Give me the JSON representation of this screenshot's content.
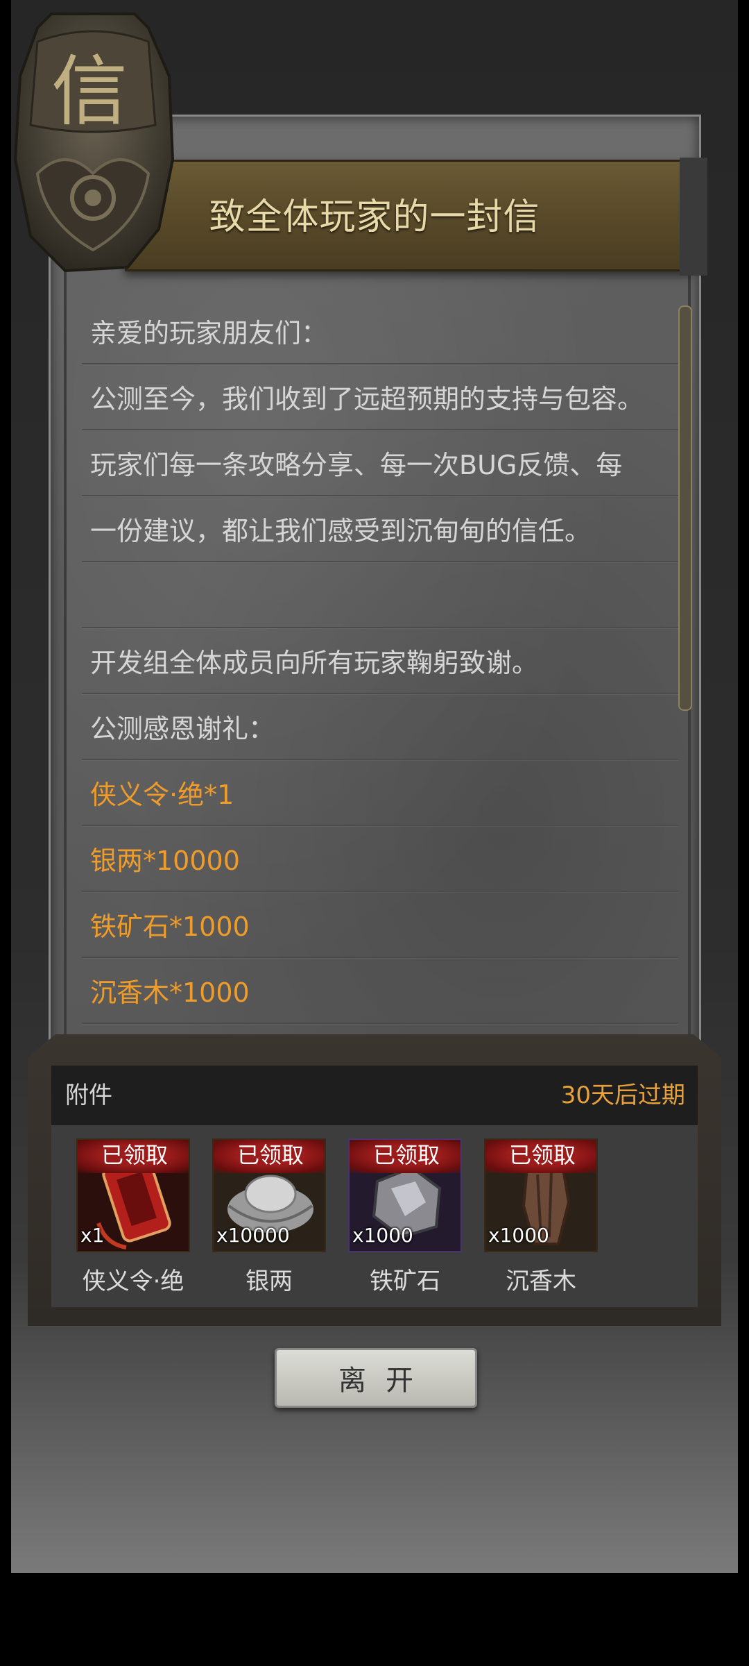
{
  "letter": {
    "title": "致全体玩家的一封信",
    "badge_char": "信",
    "lines": [
      {
        "text": "亲爱的玩家朋友们：",
        "gold": false
      },
      {
        "text": "公测至今，我们收到了远超预期的支持与包容。",
        "gold": false
      },
      {
        "text": "玩家们每一条攻略分享、每一次BUG反馈、每",
        "gold": false
      },
      {
        "text": "一份建议，都让我们感受到沉甸甸的信任。",
        "gold": false
      },
      {
        "text": "",
        "gold": false
      },
      {
        "text": "开发组全体成员向所有玩家鞠躬致谢。",
        "gold": false
      },
      {
        "text": "公测感恩谢礼：",
        "gold": false
      },
      {
        "text": "侠义令·绝*1",
        "gold": true
      },
      {
        "text": "银两*10000",
        "gold": true
      },
      {
        "text": "铁矿石*1000",
        "gold": true
      },
      {
        "text": "沉香木*1000",
        "gold": true
      }
    ]
  },
  "attachments": {
    "label": "附件",
    "expire": "30天后过期",
    "items": [
      {
        "name": "侠义令·绝",
        "qty": "x1",
        "status": "已领取",
        "icon": "token-plaque-icon"
      },
      {
        "name": "银两",
        "qty": "x10000",
        "status": "已领取",
        "icon": "silver-ingot-icon"
      },
      {
        "name": "铁矿石",
        "qty": "x1000",
        "status": "已领取",
        "icon": "iron-ore-icon"
      },
      {
        "name": "沉香木",
        "qty": "x1000",
        "status": "已领取",
        "icon": "agarwood-icon"
      }
    ]
  },
  "leave_button": "离开",
  "colors": {
    "gold_text": "#ef9c2a",
    "title_text": "#e8d9a8",
    "claimed_red": "#9c1c1c"
  }
}
